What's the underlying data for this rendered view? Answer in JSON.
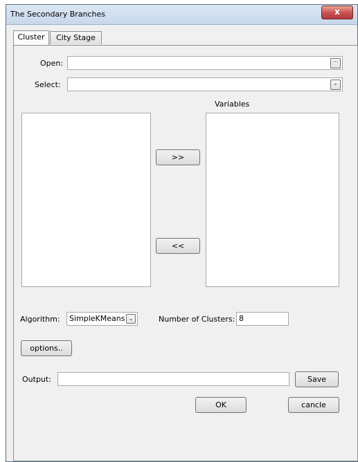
{
  "window": {
    "title": "The Secondary Branches",
    "close_glyph": "x"
  },
  "tabs": [
    {
      "label": "Cluster",
      "active": true
    },
    {
      "label": "City Stage",
      "active": false
    }
  ],
  "open": {
    "label": "Open:",
    "value": "",
    "browse_glyph": "···"
  },
  "select": {
    "label": "Select:",
    "value": "",
    "arrow_glyph": "⌄"
  },
  "variables": {
    "label": "Variables"
  },
  "transfer": {
    "add_label": ">>",
    "remove_label": "<<"
  },
  "algorithm": {
    "label": "Algorithm:",
    "value": "SimpleKMeans",
    "arrow_glyph": "⌄"
  },
  "clusters": {
    "label": "Number of Clusters:",
    "value": "8"
  },
  "options": {
    "label": "options.."
  },
  "output": {
    "label": "Output:",
    "value": "",
    "save_label": "Save"
  },
  "actions": {
    "ok_label": "OK",
    "cancel_label": "cancle"
  }
}
